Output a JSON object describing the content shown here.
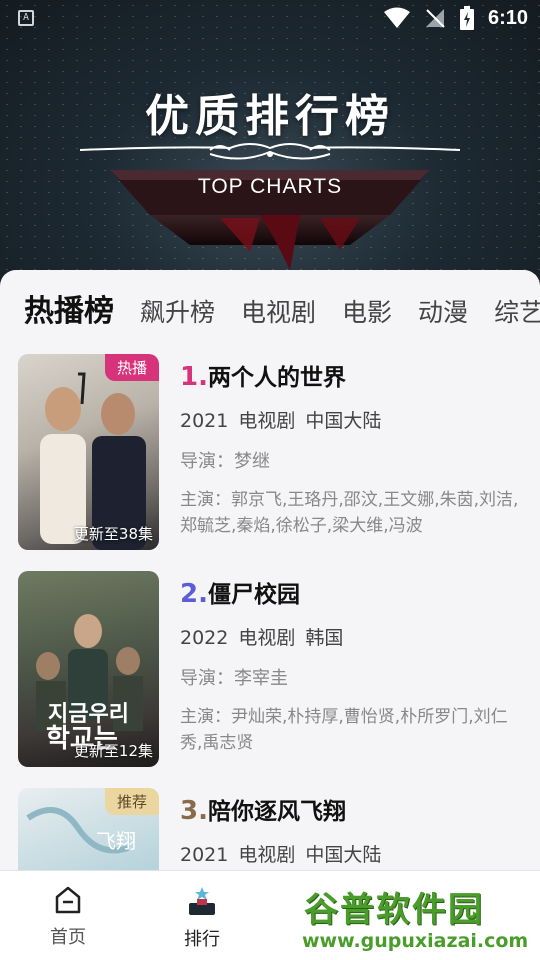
{
  "status_bar": {
    "time": "6:10",
    "left_icon_letter": "A"
  },
  "header": {
    "title": "优质排行榜",
    "subtitle": "TOP CHARTS"
  },
  "tabs": [
    {
      "label": "热播榜",
      "active": true
    },
    {
      "label": "飙升榜",
      "active": false
    },
    {
      "label": "电视剧",
      "active": false
    },
    {
      "label": "电影",
      "active": false
    },
    {
      "label": "动漫",
      "active": false
    },
    {
      "label": "综艺",
      "active": false
    }
  ],
  "items": [
    {
      "rank": "1.",
      "rank_color": "#d7337a",
      "title": "两个人的世界",
      "year": "2021",
      "category": "电视剧",
      "region": "中国大陆",
      "director": "导演：梦继",
      "cast": "主演：郭京飞,王珞丹,邵汶,王文娜,朱茵,刘洁,郑毓芝,秦焰,徐松子,梁大维,冯波",
      "badge": "热播",
      "badge_color": "#d7337a",
      "update": "更新至38集"
    },
    {
      "rank": "2.",
      "rank_color": "#5b5fd6",
      "title": "僵尸校园",
      "year": "2022",
      "category": "电视剧",
      "region": "韩国",
      "director": "导演：李宰圭",
      "cast": "主演：尹灿荣,朴持厚,曹怡贤,朴所罗门,刘仁秀,禹志贤",
      "badge": "",
      "badge_color": "",
      "update": "更新至12集"
    },
    {
      "rank": "3.",
      "rank_color": "#8a6a4a",
      "title": "陪你逐风飞翔",
      "year": "2021",
      "category": "电视剧",
      "region": "中国大陆",
      "director": "",
      "cast": "",
      "badge": "推荐",
      "badge_color": "#e8c98a",
      "update": ""
    }
  ],
  "bottom_nav": [
    {
      "label": "首页",
      "icon": "home-icon",
      "active": false
    },
    {
      "label": "排行",
      "icon": "rank-podium-icon",
      "active": true
    }
  ],
  "watermark": {
    "text": "谷普软件园",
    "url": "www.gupuxiazai.com"
  }
}
